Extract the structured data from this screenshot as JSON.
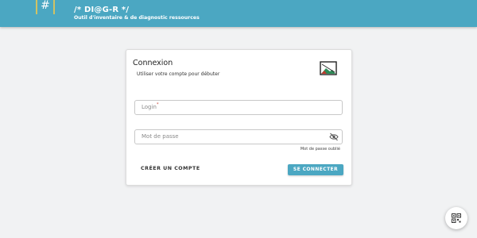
{
  "header": {
    "logo_glyph": "#",
    "title": "/* DI@G-R */",
    "subtitle": "Outil d'inventaire & de diagnostic ressources"
  },
  "login_card": {
    "title": "Connexion",
    "subtitle": "Utiliser votre compte pour débuter",
    "image_icon": "landscape-image-icon",
    "login_field": {
      "label": "Login",
      "required_mark": "*",
      "value": ""
    },
    "password_field": {
      "label": "Mot de passe",
      "value": "",
      "toggle_icon": "eye-off-icon"
    },
    "forgot_password": "Mot de passe oublié",
    "create_account": "CRÉER UN COMPTE",
    "connect": "SE CONNECTER"
  },
  "fab": {
    "icon": "qr-code-icon"
  },
  "colors": {
    "primary": "#4ba7c2",
    "logo_accent": "#f2c94c",
    "background": "#f1f2f3"
  }
}
